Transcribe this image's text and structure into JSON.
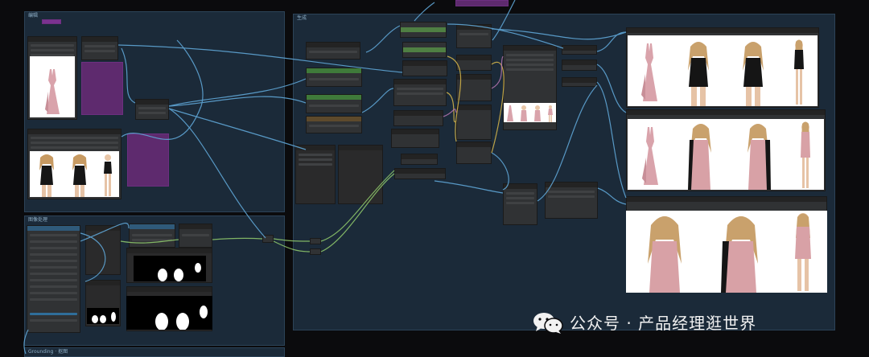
{
  "groups": {
    "top_left": {
      "title": "编辑"
    },
    "bottom_left": {
      "title": "图像处理"
    },
    "bottom_strip": {
      "title": "Grounding · 抠图"
    },
    "main": {
      "title": "生成"
    }
  },
  "watermark": {
    "text": "公众号 · 产品经理逛世界",
    "icon": "wechat-icon"
  },
  "colors": {
    "canvas_bg": "#0b0b0d",
    "group_bg": "#1b2a39",
    "node_bg": "#303234",
    "wire_blue": "#5fa6d6",
    "wire_green": "#8cc46a",
    "wire_yellow": "#d9b84a",
    "wire_pink": "#c27bb8",
    "purple_node": "#5e2a6e"
  },
  "image_panels": [
    {
      "name": "garment-reference",
      "figures": [
        "dress"
      ]
    },
    {
      "name": "model-reference",
      "figures": [
        "model-black",
        "model-black",
        "model-black-full"
      ]
    },
    {
      "name": "output-black",
      "figures": [
        "dress",
        "model-black",
        "model-black",
        "model-black-full"
      ]
    },
    {
      "name": "output-pink",
      "figures": [
        "dress",
        "model-pink",
        "model-pink",
        "model-pink-full"
      ]
    },
    {
      "name": "output-pink-large",
      "figures": [
        "model-pink",
        "model-pink",
        "model-pink-full"
      ]
    },
    {
      "name": "preview-small",
      "figures": [
        "dress",
        "model-pink",
        "model-pink",
        "model-pink-full"
      ]
    }
  ]
}
